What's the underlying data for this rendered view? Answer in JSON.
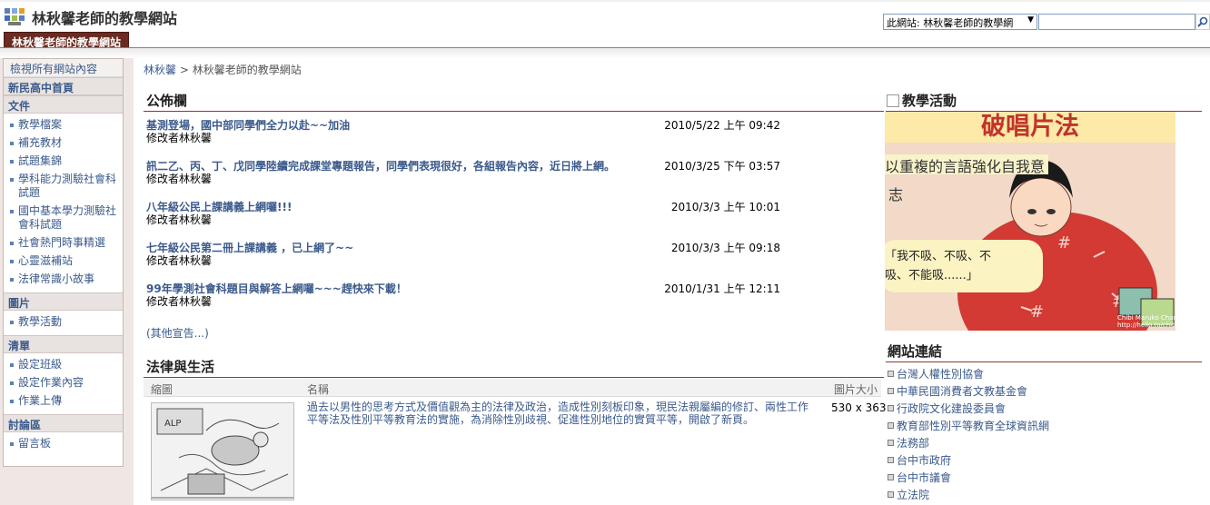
{
  "header": {
    "site_title": "林秋馨老師的教學網站",
    "tab_label": "林秋馨老師的教學網站",
    "search_scope": "此網站: 林秋馨老師的教學網",
    "search_placeholder": ""
  },
  "breadcrumb": {
    "root": "林秋馨",
    "separator": " > ",
    "current": "林秋馨老師的教學網站"
  },
  "sidebar": {
    "view_all": "檢視所有網站內容",
    "home": "新民高中首頁",
    "sections": [
      {
        "title": "文件",
        "items": [
          "教學檔案",
          "補充教材",
          "試題集錦",
          "學科能力測驗社會科試題",
          "國中基本學力測驗社會科試題",
          "社會熱門時事精選",
          "心靈滋補站",
          "法律常識小故事"
        ]
      },
      {
        "title": "圖片",
        "items": [
          "教學活動"
        ]
      },
      {
        "title": "清單",
        "items": [
          "設定班級",
          "設定作業內容",
          "作業上傳"
        ]
      },
      {
        "title": "討論區",
        "items": [
          "留言板"
        ]
      }
    ]
  },
  "announcements": {
    "title": "公佈欄",
    "items": [
      {
        "title": "基測登場，國中部同學們全力以赴~~加油",
        "by": "修改者林秋馨",
        "date": "2010/5/22 上午 09:42"
      },
      {
        "title": "訊二乙、丙、丁、戊同學陸續完成課堂專題報告，同學們表現很好，各組報告內容，近日將上網。",
        "by": "修改者林秋馨",
        "date": "2010/3/25 下午 03:57"
      },
      {
        "title": "八年級公民上課講義上網囉!!!",
        "by": "修改者林秋馨",
        "date": "2010/3/3 上午 10:01"
      },
      {
        "title": "七年級公民第二冊上課講義 ，已上網了~~",
        "by": "修改者林秋馨",
        "date": "2010/3/3 上午 09:18"
      },
      {
        "title": "99年學測社會科題目與解答上網囉~~~趕快來下載！",
        "by": "修改者林秋馨",
        "date": "2010/1/31 上午 12:11"
      }
    ],
    "more": "(其他宣告...)"
  },
  "law": {
    "title": "法律與生活",
    "columns": {
      "thumb": "縮圖",
      "name": "名稱",
      "size": "圖片大小"
    },
    "row": {
      "description": "過去以男性的思考方式及價值觀為主的法律及政治，造成性別刻板印象，現民法親屬編的修訂、兩性工作平等法及性別平等教育法的實施，為消除性別歧視、促進性別地位的實質平等，開啟了新頁。",
      "size": "530 x 363"
    }
  },
  "activities": {
    "title": "教學活動",
    "image_text": {
      "banner": "破唱片法",
      "line1": "以重複的言語強化自我意",
      "line2": "志",
      "bubble1": "「我不吸、不吸、不",
      "bubble2": "吸、不能吸......」",
      "credit1": "Chibi Maruko Chan",
      "credit2": "http://hello.to/chibimaruko"
    }
  },
  "site_links": {
    "title": "網站連結",
    "items": [
      "台灣人權性別協會",
      "中華民國消費者文教基金會",
      "行政院文化建設委員會",
      "教育部性別平等教育全球資訊網",
      "法務部",
      "台中市政府",
      "台中市議會",
      "立法院"
    ]
  }
}
